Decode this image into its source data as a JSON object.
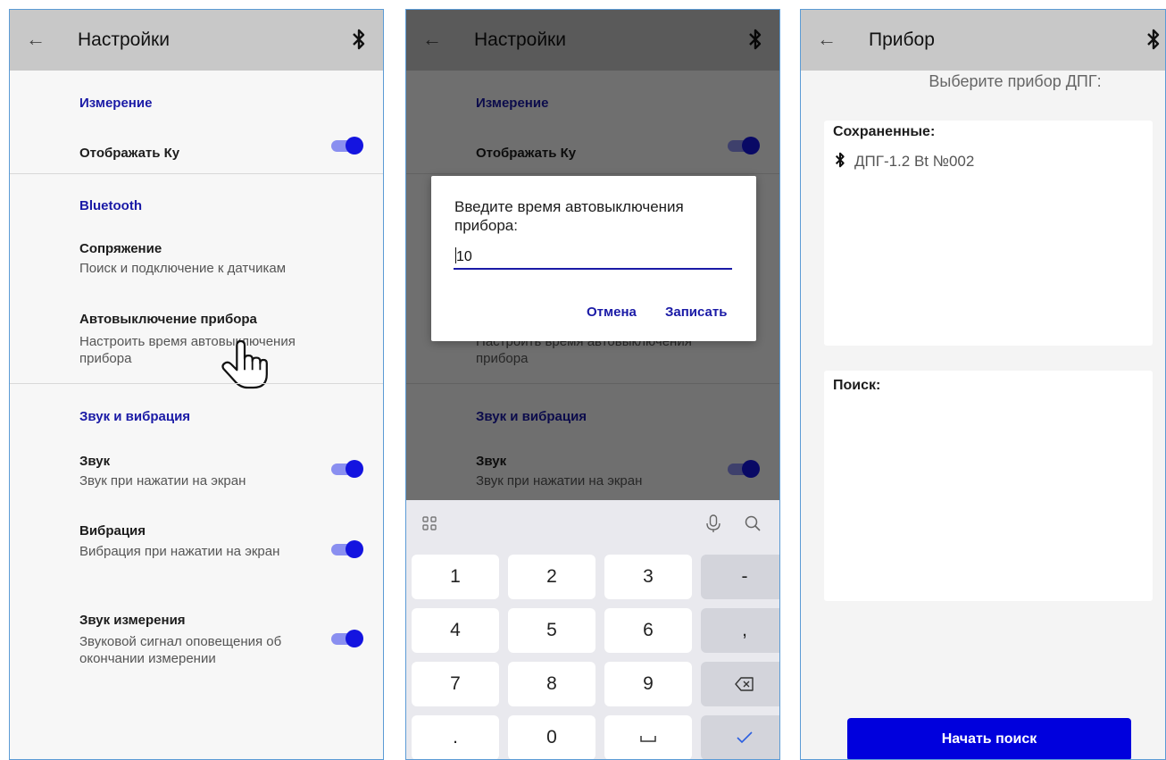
{
  "settings": {
    "title": "Настройки",
    "sections": [
      {
        "title": "Измерение"
      },
      {
        "title": "Bluetooth"
      },
      {
        "title": "Звук и вибрация"
      }
    ],
    "items": {
      "display_ky": {
        "title": "Отображать Ку",
        "enabled": true
      },
      "pairing": {
        "title": "Сопряжение",
        "subtitle": "Поиск и подключение к датчикам"
      },
      "autooff": {
        "title": "Автовыключение прибора",
        "subtitle": "Настроить время автовыключения прибора"
      },
      "sound": {
        "title": "Звук",
        "subtitle": "Звук при нажатии на экран",
        "enabled": true
      },
      "vibration": {
        "title": "Вибрация",
        "subtitle": "Вибрация при нажатии на экран",
        "enabled": true
      },
      "measure_sound": {
        "title": "Звук измерения",
        "subtitle": "Звуковой сигнал оповещения об окончании измерении",
        "enabled": true
      }
    }
  },
  "dialog": {
    "title": "Введите время автовыключения прибора:",
    "value": "10",
    "cancel_label": "Отмена",
    "save_label": "Записать"
  },
  "keyboard": {
    "top_icons": [
      "grid-icon",
      "microphone-icon",
      "search-icon"
    ],
    "rows": [
      [
        "1",
        "2",
        "3",
        "-"
      ],
      [
        "4",
        "5",
        "6",
        ","
      ],
      [
        "7",
        "8",
        "9",
        "backspace"
      ],
      [
        ".",
        "0",
        "space",
        "done"
      ]
    ]
  },
  "device": {
    "title": "Прибор",
    "heading": "Выберите прибор ДПГ:",
    "saved_label": "Сохраненные:",
    "saved_devices": [
      "ДПГ-1.2 Bt №002"
    ],
    "search_label": "Поиск:",
    "start_search_label": "Начать поиск"
  },
  "colors": {
    "accent": "#1a1aa6",
    "toggle_on": "#1414e0",
    "button_bg": "#0000dd",
    "appbar_bg": "#c8c8c8"
  }
}
